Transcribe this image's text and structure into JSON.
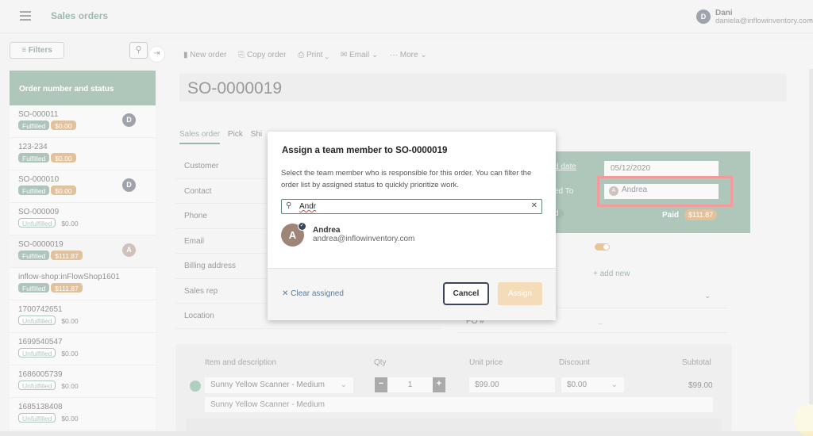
{
  "header": {
    "title": "Sales orders",
    "user_initial": "D",
    "user_name": "Dani",
    "user_email": "daniela@inflowinventory.com"
  },
  "left": {
    "filters_label": "≡ Filters",
    "list_header": "Order number and status",
    "orders": [
      {
        "number": "SO-000011",
        "status": "Fulfilled",
        "amount": "$0.00",
        "paid": true,
        "avatar": "D"
      },
      {
        "number": "123-234",
        "status": "Fulfilled",
        "amount": "$0.00",
        "paid": true,
        "avatar": ""
      },
      {
        "number": "SO-000010",
        "status": "Fulfilled",
        "amount": "$0.00",
        "paid": true,
        "avatar": "D"
      },
      {
        "number": "SO-000009",
        "status": "Unfulfilled",
        "amount": "$0.00",
        "paid": false,
        "avatar": ""
      },
      {
        "number": "SO-0000019",
        "status": "Fulfilled",
        "amount": "$111.87",
        "paid": true,
        "avatar": "A"
      },
      {
        "number": "inflow-shop:inFlowShop1601",
        "status": "Fulfilled",
        "amount": "$111.87",
        "paid": true,
        "avatar": ""
      },
      {
        "number": "1700742651",
        "status": "Unfulfilled",
        "amount": "$0.00",
        "paid": false,
        "avatar": ""
      },
      {
        "number": "1699540547",
        "status": "Unfulfilled",
        "amount": "$0.00",
        "paid": false,
        "avatar": ""
      },
      {
        "number": "1686005739",
        "status": "Unfulfilled",
        "amount": "$0.00",
        "paid": false,
        "avatar": ""
      },
      {
        "number": "1685138408",
        "status": "Unfulfilled",
        "amount": "$0.00",
        "paid": false,
        "avatar": ""
      }
    ]
  },
  "toolbar": {
    "new_order": "New order",
    "copy_order": "Copy order",
    "print": "Print",
    "email": "Email",
    "more": "More"
  },
  "order": {
    "number": "SO-0000019",
    "tabs": [
      "Sales order",
      "Pick",
      "Shi"
    ],
    "fields": [
      "Customer",
      "Contact",
      "Phone",
      "Email",
      "Billing address",
      "Sales rep",
      "Location"
    ],
    "date_label": "d date",
    "date_value": "05/12/2020",
    "assigned_label": "ed To",
    "assigned_initial": "A",
    "assigned_value": "Andrea",
    "status_partial": "d",
    "paid_label": "Paid",
    "paid_amount": "$111.87",
    "add_new": "+ add new",
    "po_label": "PO #",
    "po_value": "_"
  },
  "items": {
    "headers": {
      "item": "Item and description",
      "qty": "Qty",
      "unit_price": "Unit price",
      "discount": "Discount",
      "subtotal": "Subtotal"
    },
    "product": "Sunny Yellow Scanner - Medium",
    "qty": "1",
    "unit_price": "$99.00",
    "discount": "$0.00",
    "subtotal": "$99.00",
    "description": "Sunny Yellow Scanner - Medium"
  },
  "modal": {
    "title": "Assign a team member to SO-0000019",
    "description": "Select the team member who is responsible for this order. You can filter the order list by assigned status to quickly prioritize work.",
    "search_value": "Andr",
    "option_initial": "A",
    "option_name": "Andrea",
    "option_email": "andrea@inflowinventory.com",
    "clear_label": "Clear assigned",
    "cancel_label": "Cancel",
    "assign_label": "Assign"
  },
  "colors": {
    "brand_green": "#5e8d76",
    "accent_orange": "#c5843a",
    "highlight_red": "#e73737"
  }
}
